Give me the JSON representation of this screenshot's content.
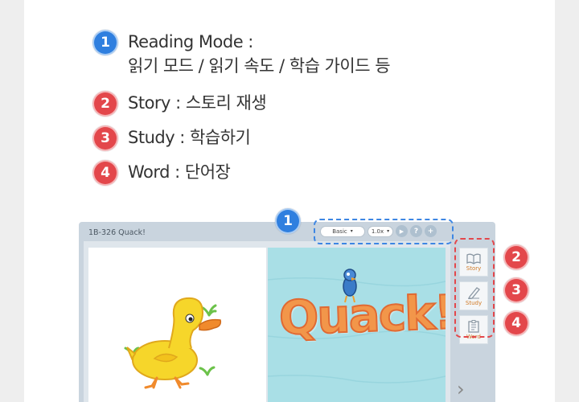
{
  "legend": [
    {
      "number": "1",
      "color": "blue",
      "lines": [
        "Reading Mode :",
        "읽기 모드 / 읽기 속도 / 학습 가이드 등"
      ]
    },
    {
      "number": "2",
      "color": "red",
      "lines": [
        "Story : 스토리 재생"
      ]
    },
    {
      "number": "3",
      "color": "red",
      "lines": [
        "Study : 학습하기"
      ]
    },
    {
      "number": "4",
      "color": "red",
      "lines": [
        "Word : 단어장"
      ]
    }
  ],
  "app": {
    "title": "1B-326  Quack!",
    "toolbar": {
      "mode_value": "Basic",
      "speed_value": "1.0x",
      "play_icon": "play-icon",
      "help_label": "?",
      "plus_label": "+"
    },
    "side_menu": [
      {
        "label": "Story",
        "icon": "book-icon"
      },
      {
        "label": "Study",
        "icon": "pencil-icon"
      },
      {
        "label": "Word",
        "icon": "word-card-icon"
      }
    ],
    "callout_numbers": {
      "top": "1",
      "story": "2",
      "study": "3",
      "word": "4"
    },
    "book_title": "Quack!"
  },
  "colors": {
    "blue_badge": "#2f7fdf",
    "red_badge": "#e3474b",
    "accent_orange": "#d17a26"
  }
}
